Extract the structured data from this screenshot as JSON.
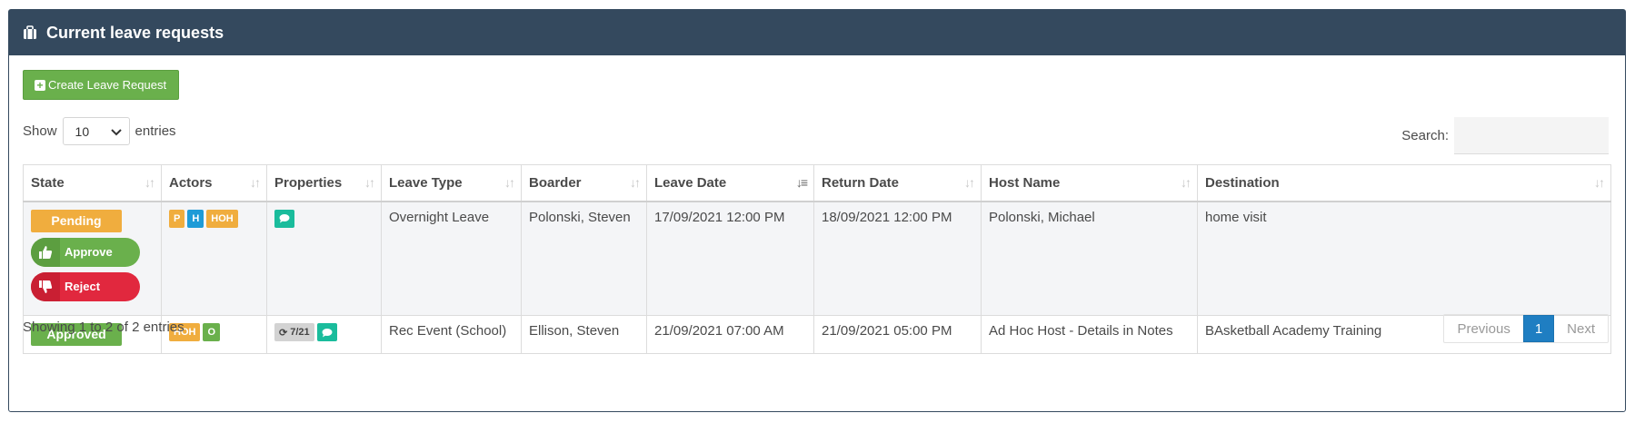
{
  "panel": {
    "title": "Current leave requests"
  },
  "toolbar": {
    "create_label": "Create Leave Request"
  },
  "length": {
    "show_label": "Show",
    "value": "10",
    "entries_label": "entries"
  },
  "search": {
    "label": "Search:",
    "value": ""
  },
  "table": {
    "headers": [
      "State",
      "Actors",
      "Properties",
      "Leave Type",
      "Boarder",
      "Leave Date",
      "Return Date",
      "Host Name",
      "Destination"
    ],
    "sorted_column": "Leave Date",
    "rows": [
      {
        "state": "Pending",
        "state_color": "#f0ad3e",
        "actions": {
          "approve": "Approve",
          "reject": "Reject"
        },
        "actors": [
          "P",
          "H",
          "HOH"
        ],
        "properties": {
          "count": "",
          "has_notes": true
        },
        "leave_type": "Overnight Leave",
        "boarder": "Polonski, Steven",
        "leave_date": "17/09/2021 12:00 PM",
        "return_date": "18/09/2021 12:00 PM",
        "host_name": "Polonski, Michael",
        "destination": "home visit"
      },
      {
        "state": "Approved",
        "state_color": "#6ab04c",
        "actors": [
          "HOH",
          "O"
        ],
        "properties": {
          "count": "7/21",
          "has_notes": true
        },
        "leave_type": "Rec Event (School)",
        "boarder": "Ellison, Steven",
        "leave_date": "21/09/2021 07:00 AM",
        "return_date": "21/09/2021 05:00 PM",
        "host_name": "Ad Hoc Host - Details in Notes",
        "destination": "BAsketball Academy Training"
      }
    ]
  },
  "footer": {
    "info": "Showing 1 to 2 of 2 entries"
  },
  "pagination": {
    "previous": "Previous",
    "current": "1",
    "next": "Next"
  }
}
